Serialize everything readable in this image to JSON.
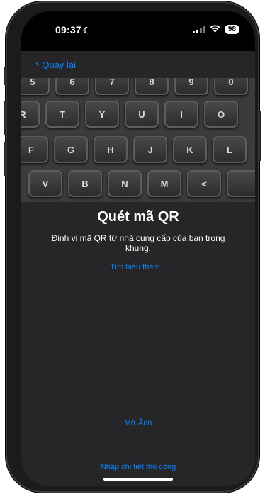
{
  "status_bar": {
    "time": "09:37",
    "battery": "98",
    "moon_icon": "moon-icon",
    "wifi_icon": "wifi-icon",
    "signal_icon": "signal-icon"
  },
  "nav": {
    "back_label": "Quay lại",
    "back_icon": "chevron-left-icon"
  },
  "camera": {
    "rows": [
      [
        "5",
        "6",
        "7",
        "8",
        "9",
        "0"
      ],
      [
        "R",
        "T",
        "Y",
        "U",
        "I",
        "O"
      ],
      [
        "F",
        "G",
        "H",
        "J",
        "K",
        "L"
      ],
      [
        "V",
        "B",
        "N",
        "M",
        "<",
        ""
      ]
    ]
  },
  "main": {
    "title": "Quét mã QR",
    "description": "Định vị mã QR từ nhà cung cấp của bạn trong khung.",
    "learn_more": "Tìm hiểu thêm...",
    "open_photo": "Mở Ảnh",
    "manual_entry": "Nhập chi tiết thủ công"
  },
  "colors": {
    "accent": "#0a84ff",
    "background": "#262628"
  }
}
